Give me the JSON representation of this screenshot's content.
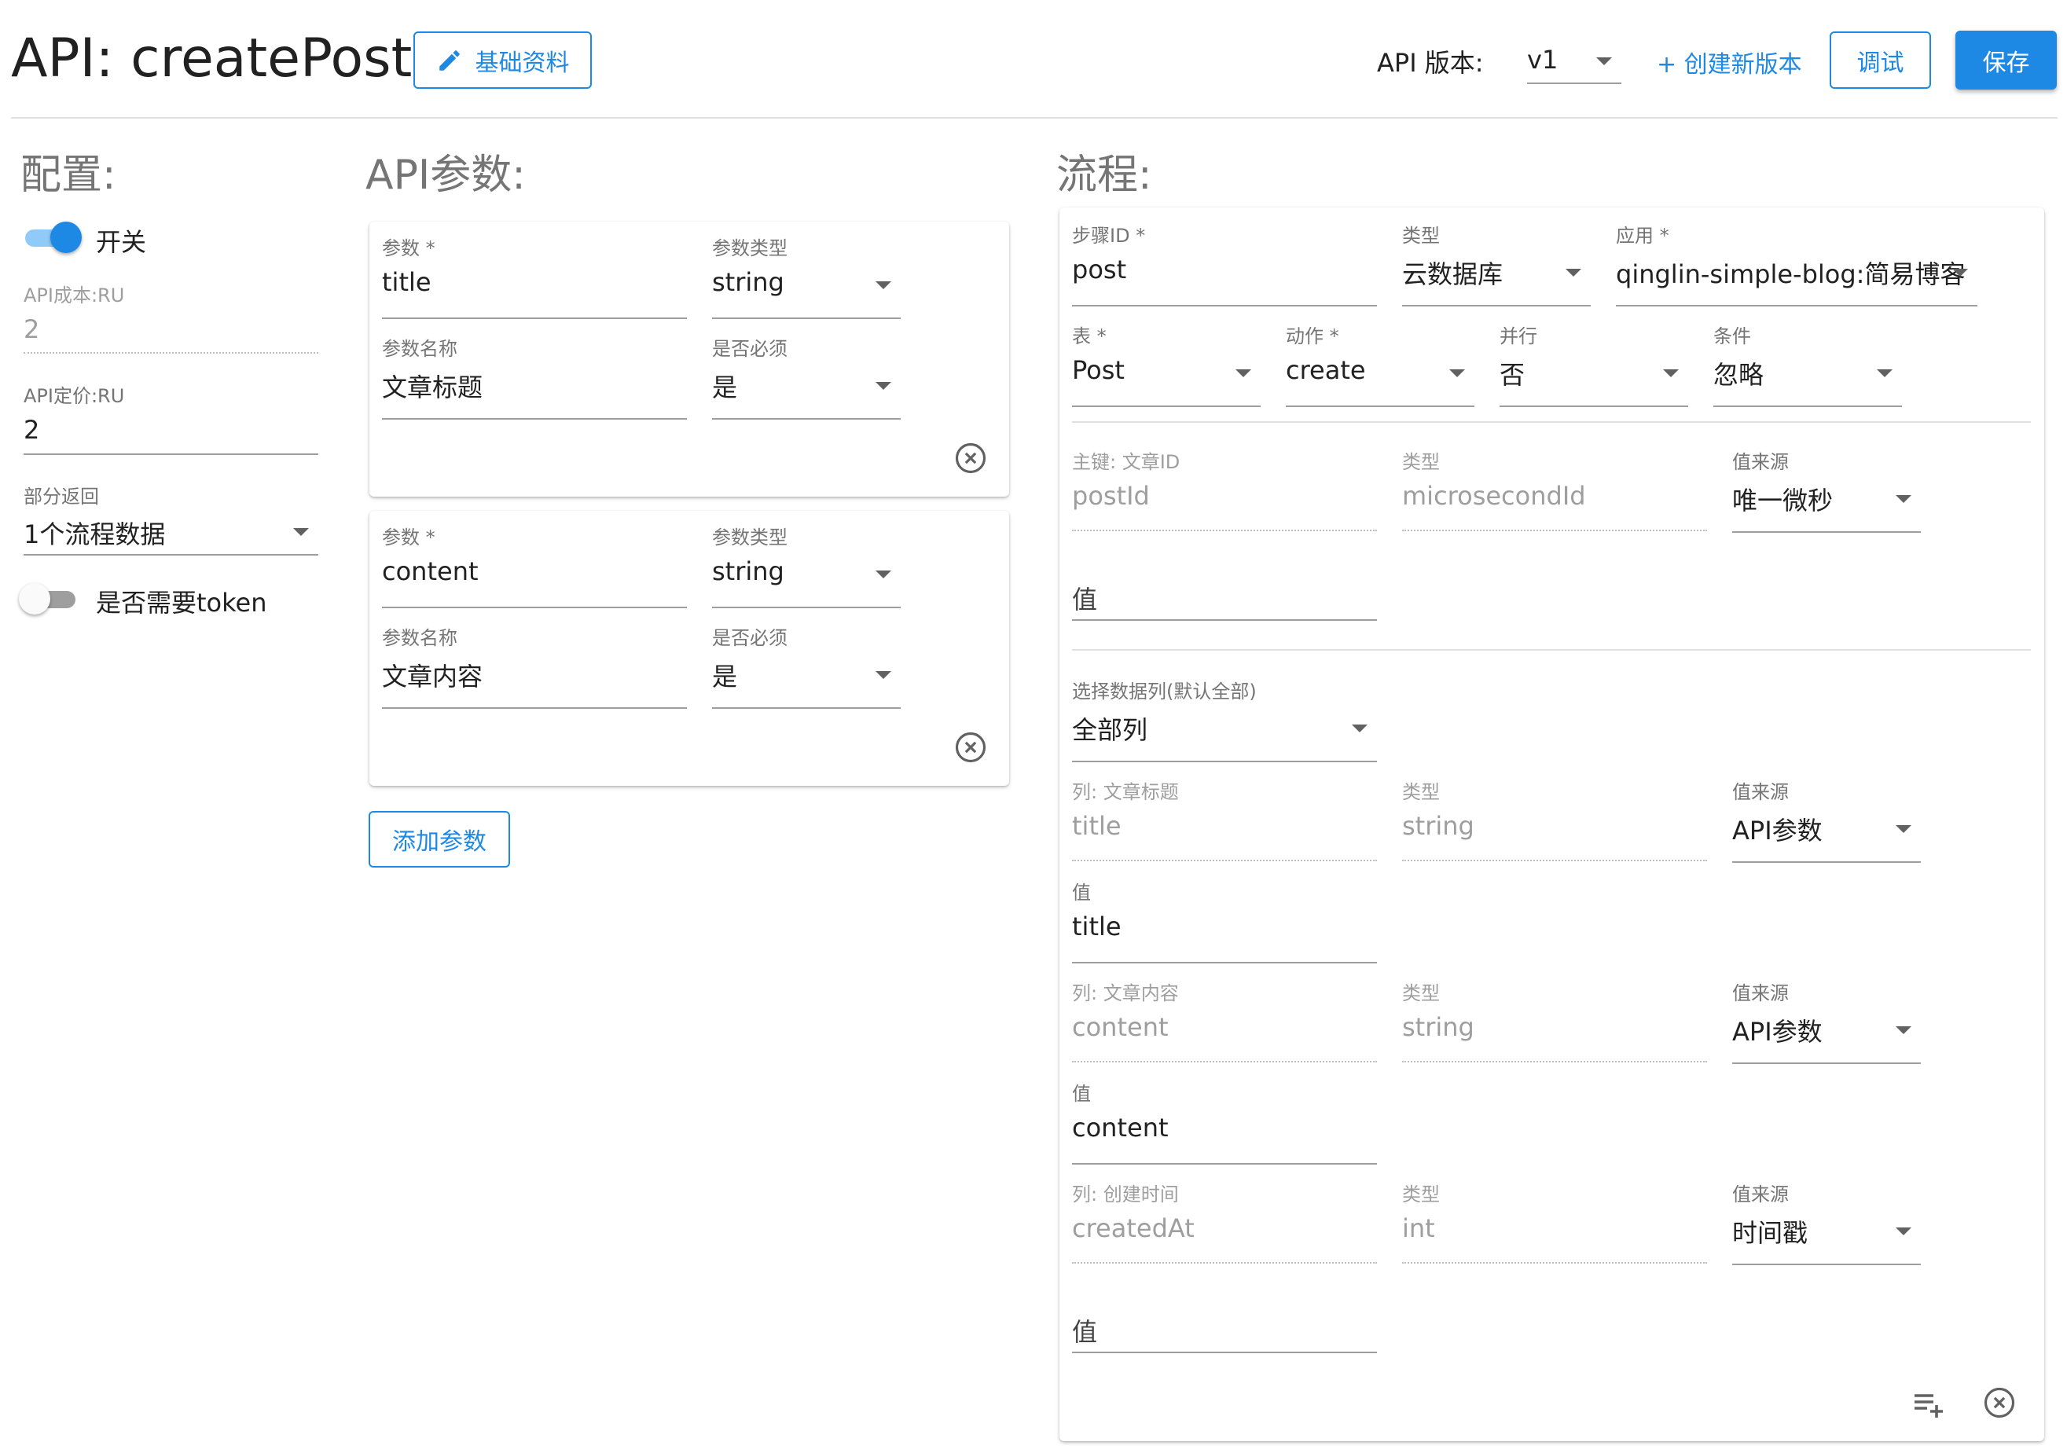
{
  "header": {
    "title": "API: createPost",
    "edit_label": "基础资料",
    "version_label": "API 版本:",
    "version_value": "v1",
    "new_version_label": "+ 创建新版本",
    "debug_label": "调试",
    "save_label": "保存"
  },
  "config": {
    "title": "配置:",
    "switch_label": "开关",
    "cost": {
      "label": "API成本:RU",
      "value": "2"
    },
    "price": {
      "label": "API定价:RU",
      "value": "2"
    },
    "partial_return": {
      "label": "部分返回",
      "value": "1个流程数据"
    },
    "token_label": "是否需要token"
  },
  "params": {
    "title": "API参数:",
    "items": [
      {
        "name_label": "参数",
        "name": "title",
        "type_label": "参数类型",
        "type": "string",
        "display_label": "参数名称",
        "display": "文章标题",
        "required_label": "是否必须",
        "required": "是"
      },
      {
        "name_label": "参数",
        "name": "content",
        "type_label": "参数类型",
        "type": "string",
        "display_label": "参数名称",
        "display": "文章内容",
        "required_label": "是否必须",
        "required": "是"
      }
    ],
    "add_label": "添加参数"
  },
  "flow": {
    "title": "流程:",
    "step_id": {
      "label": "步骤ID",
      "value": "post"
    },
    "kind": {
      "label": "类型",
      "value": "云数据库"
    },
    "app": {
      "label": "应用",
      "value": "qinglin-simple-blog:简易博客"
    },
    "table": {
      "label": "表",
      "value": "Post"
    },
    "action": {
      "label": "动作",
      "value": "create"
    },
    "parallel": {
      "label": "并行",
      "value": "否"
    },
    "condition": {
      "label": "条件",
      "value": "忽略"
    },
    "pk": {
      "label": "主键: 文章ID",
      "value": "postId",
      "type_label": "类型",
      "type": "microsecondId",
      "source_label": "值来源",
      "source": "唯一微秒",
      "value_placeholder": "值"
    },
    "select_columns": {
      "label": "选择数据列(默认全部)",
      "value": "全部列"
    },
    "columns": [
      {
        "label": "列: 文章标题",
        "name": "title",
        "type_label": "类型",
        "type": "string",
        "source_label": "值来源",
        "source": "API参数",
        "value_label": "值",
        "value": "title"
      },
      {
        "label": "列: 文章内容",
        "name": "content",
        "type_label": "类型",
        "type": "string",
        "source_label": "值来源",
        "source": "API参数",
        "value_label": "值",
        "value": "content"
      },
      {
        "label": "列: 创建时间",
        "name": "createdAt",
        "type_label": "类型",
        "type": "int",
        "source_label": "值来源",
        "source": "时间戳",
        "value_placeholder": "值"
      }
    ]
  },
  "colors": {
    "accent": "#1e88e5",
    "muted": "#757575",
    "divider": "#e0e0e0"
  },
  "icons": [
    "pencil-icon",
    "close-circle-icon",
    "playlist-add-icon",
    "chevron-down-icon"
  ]
}
